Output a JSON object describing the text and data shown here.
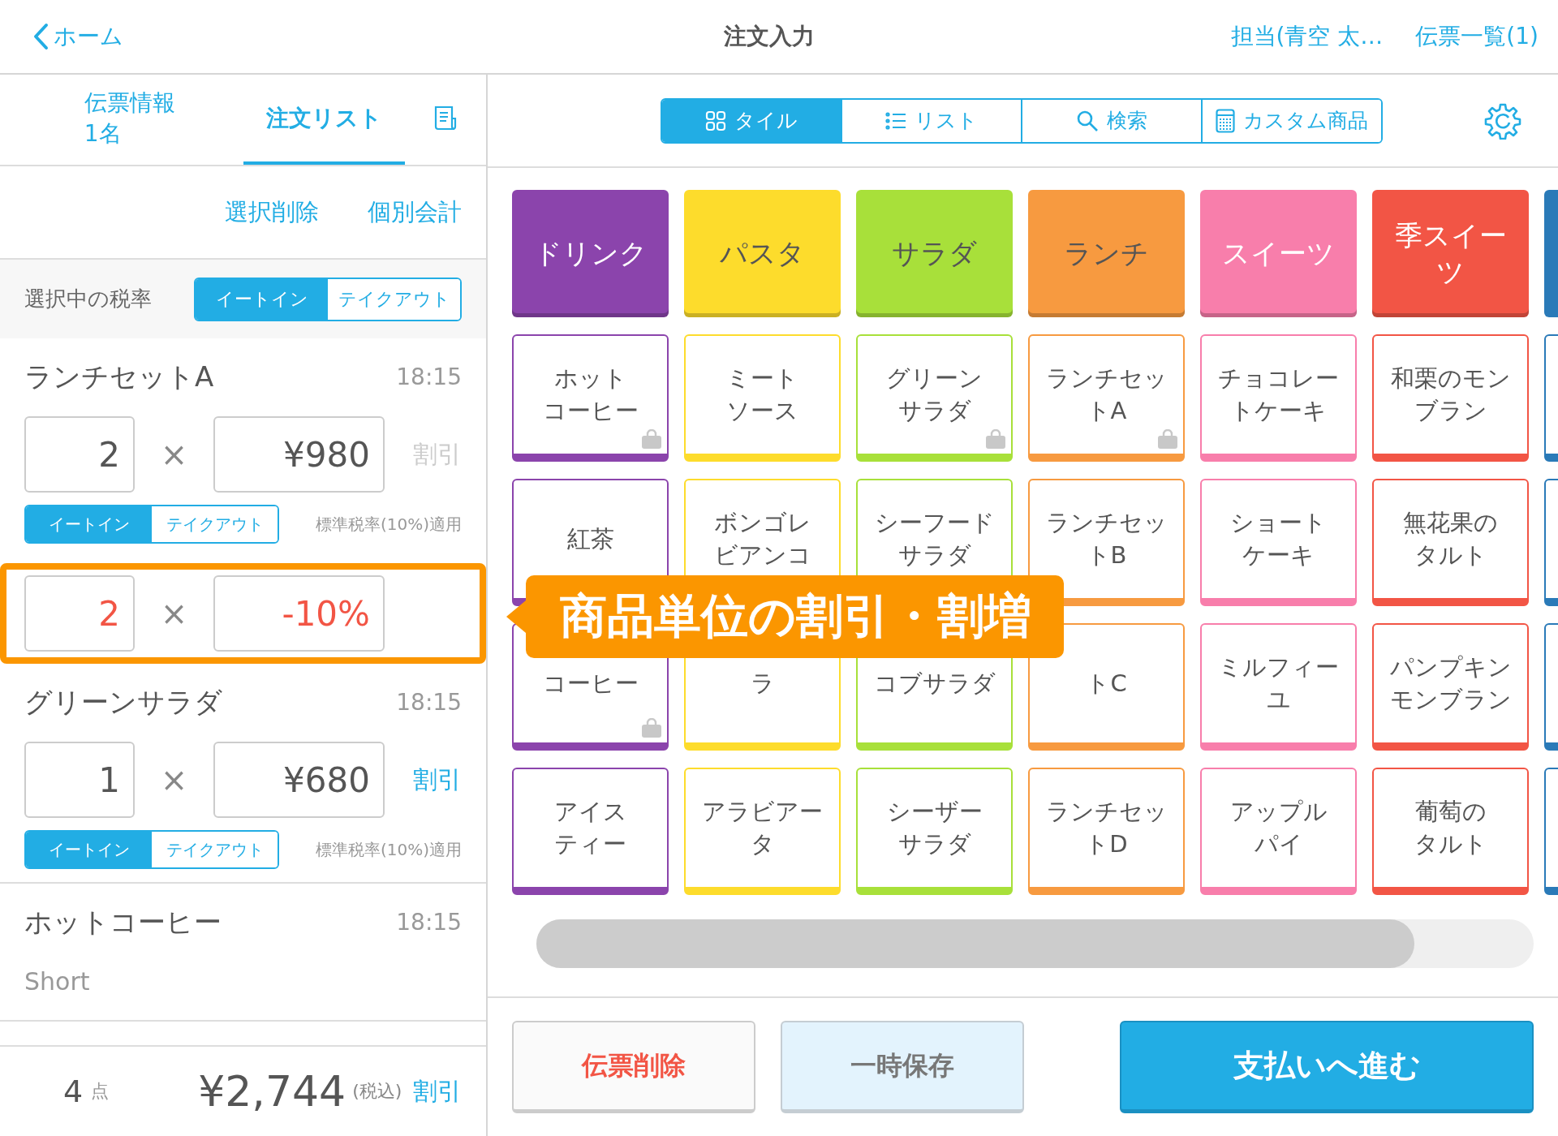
{
  "header": {
    "back_label": "ホーム",
    "title": "注文入力",
    "staff": "担当(青空 太…",
    "slips": "伝票一覧(1)"
  },
  "left": {
    "tabs": [
      {
        "kind": "text",
        "label": "伝票情報",
        "sublabel": "1名",
        "selected": false
      },
      {
        "kind": "text",
        "label": "注文リスト",
        "selected": true
      },
      {
        "kind": "icon",
        "selected": false
      }
    ],
    "actions": [
      "選択削除",
      "個別会計"
    ],
    "tax": {
      "label": "選択中の税率",
      "options": [
        {
          "label": "イートイン",
          "selected": true
        },
        {
          "label": "テイクアウト",
          "selected": false
        }
      ]
    },
    "orders": [
      {
        "kind": "item",
        "name": "ランチセットA",
        "time": "18:15",
        "qty": "2",
        "times": "×",
        "price": "¥980",
        "discount": "割引",
        "discount_enabled": false,
        "options": [
          {
            "label": "イートイン",
            "selected": true
          },
          {
            "label": "テイクアウト",
            "selected": false
          }
        ],
        "tax_note": "標準税率(10%)適用"
      },
      {
        "kind": "discount",
        "qty": "2",
        "times": "×",
        "rate": "-10%",
        "highlighted": true
      },
      {
        "kind": "item",
        "name": "グリーンサラダ",
        "time": "18:15",
        "qty": "1",
        "times": "×",
        "price": "¥680",
        "discount": "割引",
        "discount_enabled": true,
        "options": [
          {
            "label": "イートイン",
            "selected": true
          },
          {
            "label": "テイクアウト",
            "selected": false
          }
        ],
        "tax_note": "標準税率(10%)適用"
      },
      {
        "kind": "item",
        "name": "ホットコーヒー",
        "time": "18:15",
        "note": "Short"
      }
    ],
    "footer": {
      "count": "4",
      "count_unit": "点",
      "total": "¥2,744",
      "tax_label": "(税込)",
      "discount": "割引"
    }
  },
  "right": {
    "views": [
      {
        "kind": "tile",
        "label": "タイル",
        "selected": true
      },
      {
        "kind": "list",
        "label": "リスト",
        "selected": false
      },
      {
        "kind": "search",
        "label": "検索",
        "selected": false
      },
      {
        "kind": "custom",
        "label": "カスタム商品",
        "selected": false
      }
    ],
    "categories": [
      {
        "lines": [
          "ドリンク"
        ],
        "color": "#8b44ac"
      },
      {
        "lines": [
          "パスタ"
        ],
        "color": "#fddc2c"
      },
      {
        "lines": [
          "サラダ"
        ],
        "color": "#a8e03a"
      },
      {
        "lines": [
          "ランチ"
        ],
        "color": "#f79a40"
      },
      {
        "lines": [
          "スイーツ"
        ],
        "color": "#f87eab"
      },
      {
        "lines": [
          "季スイー",
          "ツ"
        ],
        "color": "#f25545"
      }
    ],
    "products": [
      [
        {
          "lines": [
            "ホット",
            "コーヒー"
          ],
          "color": "#8b44ac",
          "takeout": true
        },
        {
          "lines": [
            "ミート",
            "ソース"
          ],
          "color": "#fddc2c",
          "takeout": false
        },
        {
          "lines": [
            "グリーン",
            "サラダ"
          ],
          "color": "#a8e03a",
          "takeout": true
        },
        {
          "lines": [
            "ランチセッ",
            "トA"
          ],
          "color": "#f79a40",
          "takeout": true
        },
        {
          "lines": [
            "チョコレー",
            "トケーキ"
          ],
          "color": "#f87eab",
          "takeout": false
        },
        {
          "lines": [
            "和栗のモン",
            "ブラン"
          ],
          "color": "#f25545",
          "takeout": false
        }
      ],
      [
        {
          "lines": [
            "紅茶"
          ],
          "color": "#8b44ac"
        },
        {
          "lines": [
            "ボンゴレ",
            "ビアンコ"
          ],
          "color": "#fddc2c"
        },
        {
          "lines": [
            "シーフード",
            "サラダ"
          ],
          "color": "#a8e03a"
        },
        {
          "lines": [
            "ランチセッ",
            "トB"
          ],
          "color": "#f79a40"
        },
        {
          "lines": [
            "ショート",
            "ケーキ"
          ],
          "color": "#f87eab",
          "takeout": false
        },
        {
          "lines": [
            "無花果の",
            "タルト"
          ],
          "color": "#f25545",
          "takeout": false
        }
      ],
      [
        {
          "lines": [
            "コーヒー"
          ],
          "color": "#8b44ac",
          "takeout": true
        },
        {
          "lines": [
            "ラ"
          ],
          "color": "#fddc2c",
          "takeout": false
        },
        {
          "lines": [
            "コブサラダ"
          ],
          "color": "#a8e03a",
          "takeout": false
        },
        {
          "lines": [
            "トC"
          ],
          "color": "#f79a40",
          "takeout": false
        },
        {
          "lines": [
            "ミルフィー",
            "ユ"
          ],
          "color": "#f87eab",
          "takeout": false
        },
        {
          "lines": [
            "パンプキン",
            "モンブラン"
          ],
          "color": "#f25545",
          "takeout": false
        }
      ],
      [
        {
          "lines": [
            "アイス",
            "ティー"
          ],
          "color": "#8b44ac",
          "takeout": false
        },
        {
          "lines": [
            "アラビアー",
            "タ"
          ],
          "color": "#fddc2c",
          "takeout": false
        },
        {
          "lines": [
            "シーザー",
            "サラダ"
          ],
          "color": "#a8e03a",
          "takeout": false
        },
        {
          "lines": [
            "ランチセッ",
            "トD"
          ],
          "color": "#f79a40",
          "takeout": false
        },
        {
          "lines": [
            "アップル",
            "パイ"
          ],
          "color": "#f87eab",
          "takeout": false
        },
        {
          "lines": [
            "葡萄の",
            "タルト"
          ],
          "color": "#f25545",
          "takeout": false
        }
      ]
    ],
    "buttons": [
      {
        "kind": "danger",
        "label": "伝票削除"
      },
      {
        "kind": "secondary",
        "label": "一時保存"
      },
      {
        "kind": "primary",
        "label": "支払いへ進む"
      }
    ]
  },
  "callout": {
    "text": "商品単位の割引・割増"
  }
}
